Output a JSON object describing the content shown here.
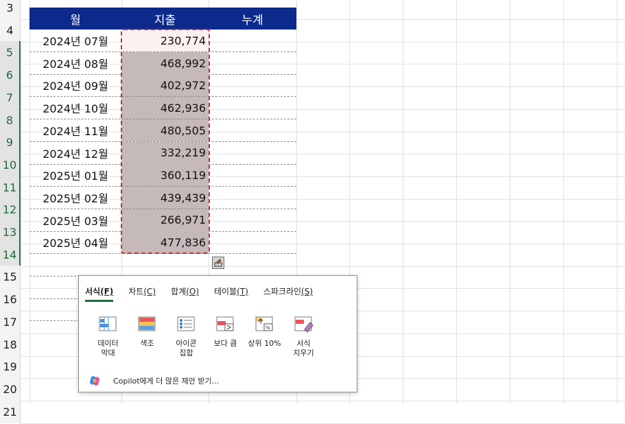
{
  "rows": [
    "3",
    "4",
    "5",
    "6",
    "7",
    "8",
    "9",
    "10",
    "11",
    "12",
    "13",
    "14",
    "15",
    "16",
    "17",
    "18",
    "19",
    "20",
    "21"
  ],
  "table": {
    "headers": [
      "월",
      "지출",
      "누계"
    ],
    "months": [
      "2024년 07월",
      "2024년 08월",
      "2024년 09월",
      "2024년 10월",
      "2024년 11월",
      "2024년 12월",
      "2025년 01월",
      "2025년 02월",
      "2025년 03월",
      "2025년 04월"
    ],
    "amounts": [
      "230,774",
      "468,992",
      "402,972",
      "462,936",
      "480,505",
      "332,219",
      "360,119",
      "439,439",
      "266,971",
      "477,836"
    ]
  },
  "quick_analysis": {
    "tabs": [
      {
        "label": "서식",
        "key": "(F)"
      },
      {
        "label": "차트",
        "key": "(C)"
      },
      {
        "label": "합계",
        "key": "(O)"
      },
      {
        "label": "테이블",
        "key": "(T)"
      },
      {
        "label": "스파크라인",
        "key": "(S)"
      }
    ],
    "tools": [
      {
        "line1": "데이터",
        "line2": "막대",
        "icon": "data-bar-icon"
      },
      {
        "line1": "색조",
        "line2": "",
        "icon": "color-scale-icon"
      },
      {
        "line1": "아이콘",
        "line2": "집합",
        "icon": "icon-set-icon"
      },
      {
        "line1": "보다 큼",
        "line2": "",
        "icon": "greater-than-icon"
      },
      {
        "line1": "상위 10%",
        "line2": "",
        "icon": "top-ten-icon"
      },
      {
        "line1": "서식",
        "line2": "지우기",
        "icon": "clear-format-icon"
      }
    ],
    "copilot_label": "Copilot에게 더 많은 제안 받기..."
  }
}
